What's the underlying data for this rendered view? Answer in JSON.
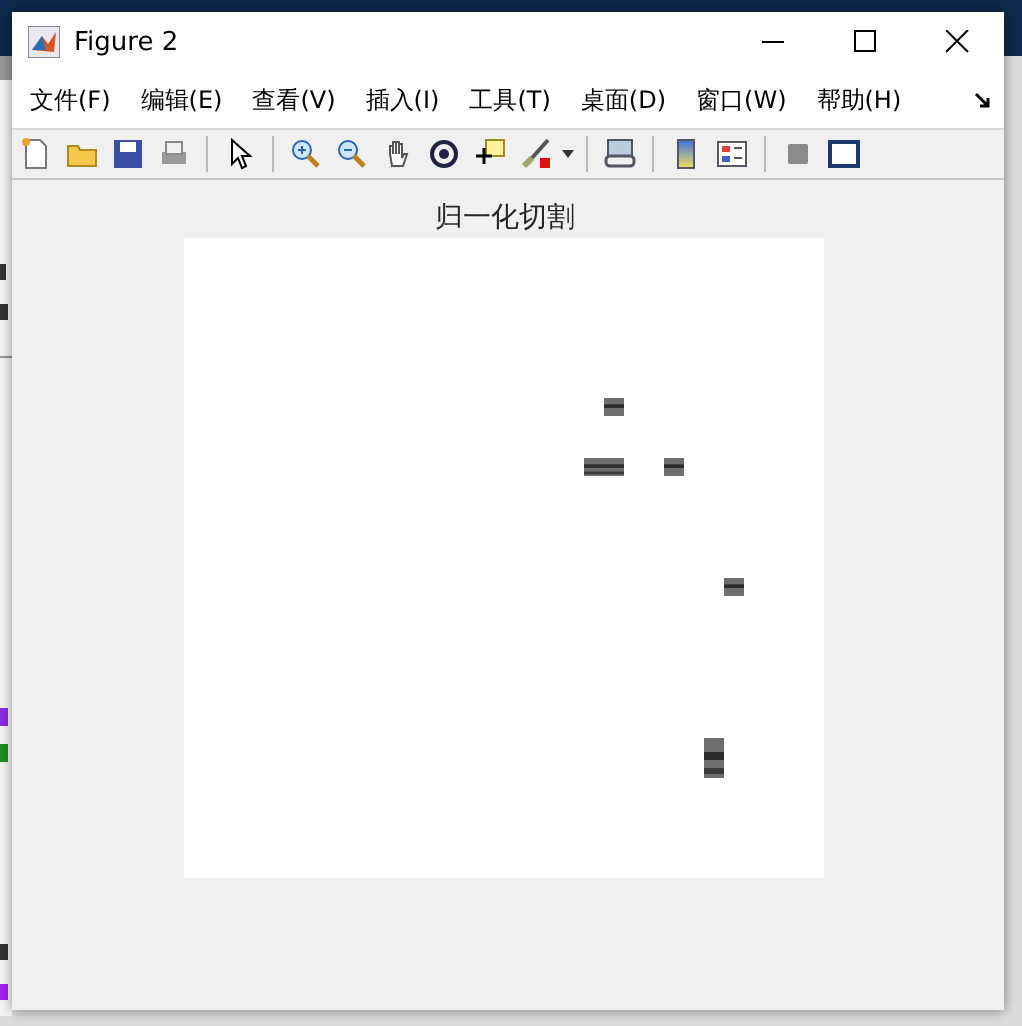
{
  "window": {
    "title": "Figure 2"
  },
  "menu": [
    "文件(F)",
    "编辑(E)",
    "查看(V)",
    "插入(I)",
    "工具(T)",
    "桌面(D)",
    "窗口(W)",
    "帮助(H)"
  ],
  "axes": {
    "title": "归一化切割",
    "kind": "picture"
  }
}
